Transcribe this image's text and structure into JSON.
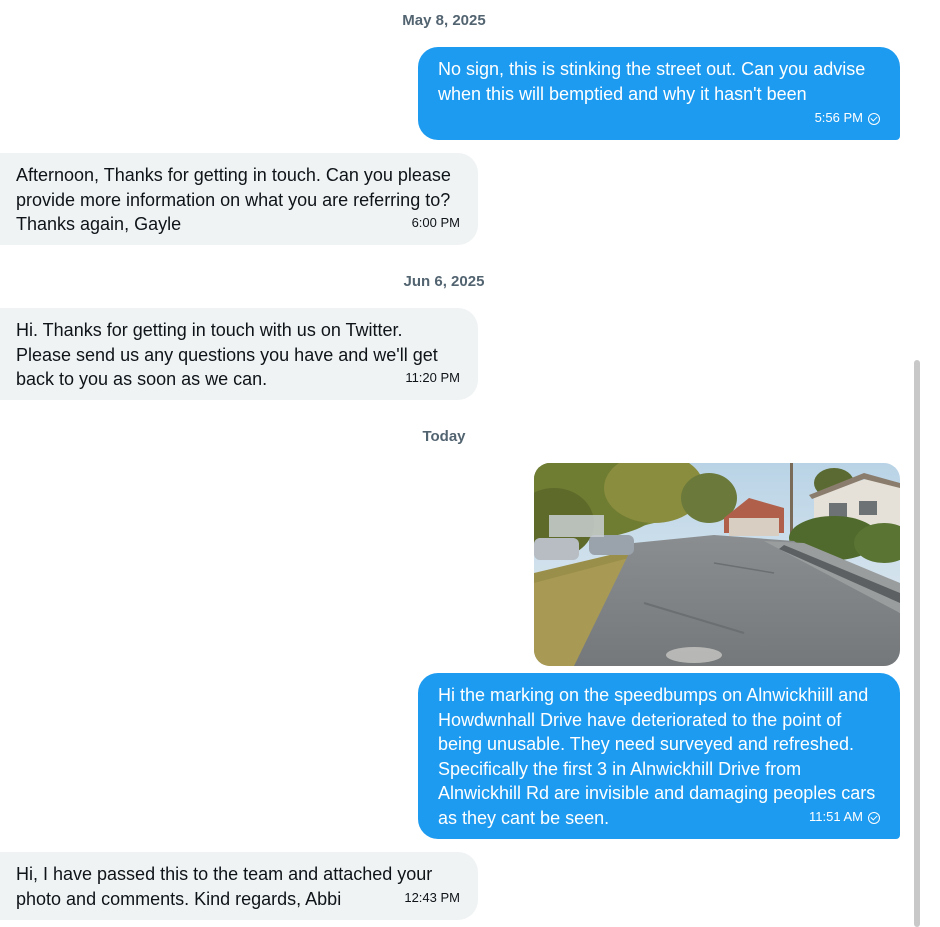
{
  "dates": {
    "d1": "May 8, 2025",
    "d2": "Jun 6, 2025",
    "d3": "Today"
  },
  "messages": [
    {
      "direction": "outgoing",
      "text": "No sign, this is stinking the street out. Can you advise when this will bemptied and why it hasn't been",
      "time": "5:56 PM",
      "status_icon": "sent-check-icon"
    },
    {
      "direction": "incoming",
      "text": "Afternoon, Thanks for getting in touch. Can you please provide more information on what you are referring to? Thanks again, Gayle",
      "time": "6:00 PM"
    },
    {
      "direction": "incoming",
      "text": "Hi. Thanks for getting in touch with us on Twitter. Please send us any questions you have and we'll get back to you as soon as we can.",
      "time": "11:20 PM"
    },
    {
      "direction": "outgoing",
      "type": "image",
      "image_icon": "street-photo"
    },
    {
      "direction": "outgoing",
      "text": "Hi the marking on the speedbumps on Alnwickhiill and Howdwnhall Drive have deteriorated to the point of being unusable. They need surveyed and refreshed. Specifically the first 3 in Alnwickhill Drive from Alnwickhill Rd are invisible and damaging peoples cars as they cant be seen.",
      "time": "11:51 AM",
      "status_icon": "sent-check-icon"
    },
    {
      "direction": "incoming",
      "text": "Hi, I have passed this to the team and attached your photo and comments. Kind regards, Abbi",
      "time": "12:43 PM"
    }
  ],
  "colors": {
    "outgoing_bubble": "#1d9bf0",
    "incoming_bubble": "#eff3f4",
    "date_text": "#536471"
  }
}
